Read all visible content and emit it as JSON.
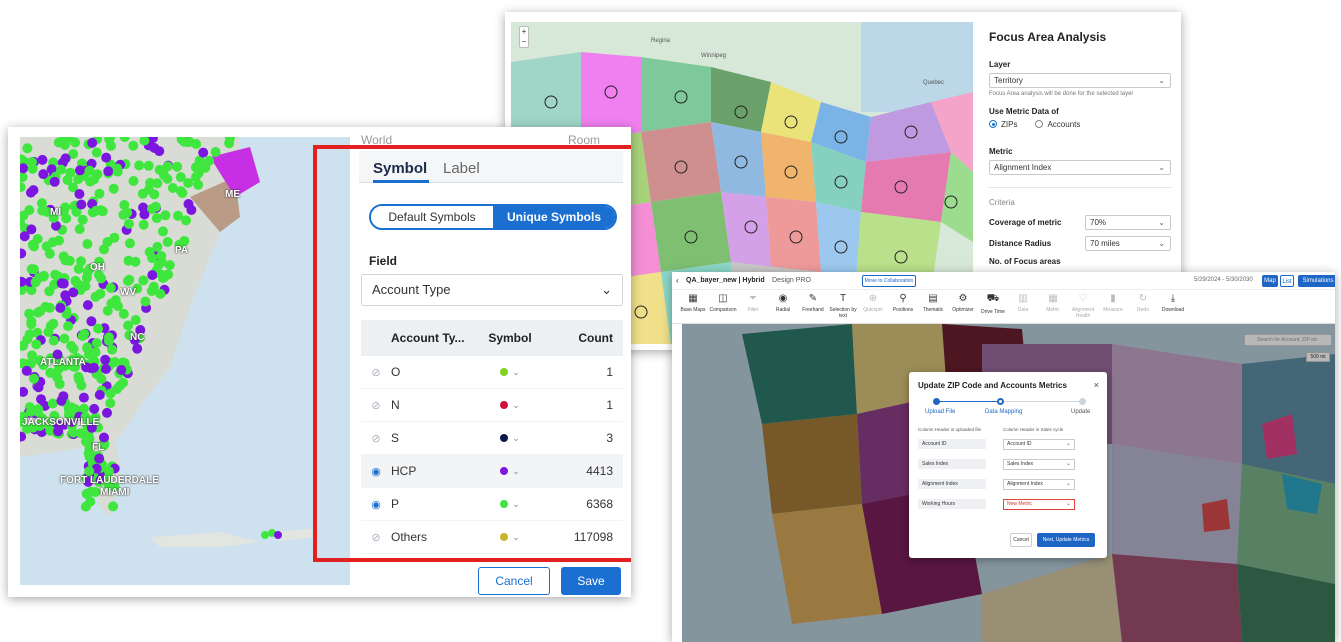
{
  "focus_panel": {
    "title": "Focus Area Analysis",
    "layer_label": "Layer",
    "layer_value": "Territory",
    "layer_hint": "Focus Area analysis will be done for the selected layer",
    "metric_data_label": "Use Metric Data of",
    "radio_zips": "ZIPs",
    "radio_accounts": "Accounts",
    "metric_label": "Metric",
    "metric_value": "Alignment Index",
    "criteria_label": "Criteria",
    "coverage_label": "Coverage of metric",
    "coverage_value": "70%",
    "radius_label": "Distance Radius",
    "radius_value": "70 miles",
    "focus_areas_label": "No. of Focus areas",
    "map_labels": {
      "regina": "Regina",
      "winnipeg": "Winnipeg",
      "quebec": "Quebec"
    }
  },
  "symbol_panel": {
    "top_left": "World",
    "top_right": "Room",
    "tabs": [
      "Symbol",
      "Label"
    ],
    "toggle": {
      "default": "Default Symbols",
      "unique": "Unique Symbols"
    },
    "field_label": "Field",
    "field_value": "Account Type",
    "table": {
      "headers": [
        "Account Ty...",
        "Symbol",
        "Count"
      ],
      "rows": [
        {
          "name": "O",
          "color": "#7ed321",
          "count": "1",
          "visible": false
        },
        {
          "name": "N",
          "color": "#d0103a",
          "count": "1",
          "visible": false
        },
        {
          "name": "S",
          "color": "#0c1a4a",
          "count": "3",
          "visible": false
        },
        {
          "name": "HCP",
          "color": "#7b16e0",
          "count": "4413",
          "visible": true
        },
        {
          "name": "P",
          "color": "#3ee63e",
          "count": "6368",
          "visible": true
        },
        {
          "name": "Others",
          "color": "#c8b22a",
          "count": "117098",
          "visible": false
        }
      ]
    },
    "cancel": "Cancel",
    "save": "Save",
    "map_labels": {
      "mi": "MI",
      "oh": "OH",
      "wv": "WV",
      "nc": "NC",
      "atlanta": "ATLANTA",
      "jacksonville": "JACKSONVILLE",
      "fl": "FL",
      "fort_lauderdale": "FORT LAUDERDALE",
      "miami": "MIAMI",
      "me": "ME",
      "pa": "PA"
    }
  },
  "hybrid_app": {
    "title": "QA_bayer_new | Hybrid",
    "subtitle": "Design PRO",
    "collab": "Move to Collaboration",
    "dates": "5/29/2024 - 5/30/2030",
    "btn_map": "Map",
    "btn_list": "List",
    "btn_sim": "Simulations",
    "tools": [
      {
        "label": "Base Maps",
        "icon": "▦",
        "dim": false
      },
      {
        "label": "Comparison",
        "icon": "◫",
        "dim": false
      },
      {
        "label": "Filter",
        "icon": "⏷",
        "dim": true
      },
      {
        "label": "Radial",
        "icon": "◉",
        "dim": false
      },
      {
        "label": "Freehand",
        "icon": "✎",
        "dim": false
      },
      {
        "label": "Selection by text",
        "icon": "T",
        "dim": false
      },
      {
        "label": "Quickpin",
        "icon": "⊕",
        "dim": true
      },
      {
        "label": "Positions",
        "icon": "⚲",
        "dim": false
      },
      {
        "label": "Thematic",
        "icon": "▤",
        "dim": false
      },
      {
        "label": "Optimizer",
        "icon": "⚙",
        "dim": false
      },
      {
        "label": "Drive Time",
        "icon": "⛟",
        "dim": false
      },
      {
        "label": "Data",
        "icon": "▥",
        "dim": true
      },
      {
        "label": "Metric",
        "icon": "▦",
        "dim": true
      },
      {
        "label": "Alignment Health",
        "icon": "♡",
        "dim": true
      },
      {
        "label": "Measure",
        "icon": "▮",
        "dim": true
      },
      {
        "label": "Redo",
        "icon": "↻",
        "dim": true
      },
      {
        "label": "Download",
        "icon": "⤓",
        "dim": false
      }
    ],
    "search_placeholder": "Search for Account, ZIP etc",
    "zoom_level": "500 mi",
    "modal": {
      "title": "Update ZIP Code and Accounts Metrics",
      "steps": [
        "Upload File",
        "Data Mapping",
        "Update"
      ],
      "col_uploaded": "Column Header in uploaded file",
      "col_sales": "Column Header in Sales cycle",
      "rows": [
        {
          "left": "Account ID",
          "right": "Account ID",
          "error": false
        },
        {
          "left": "Sales Index",
          "right": "Sales Index",
          "error": false
        },
        {
          "left": "Alignment Index",
          "right": "Alignment Index",
          "error": false
        },
        {
          "left": "Working Hours",
          "right": "New Metric",
          "error": true
        }
      ],
      "cancel": "Cancel",
      "next": "Next, Update Metrics"
    }
  }
}
